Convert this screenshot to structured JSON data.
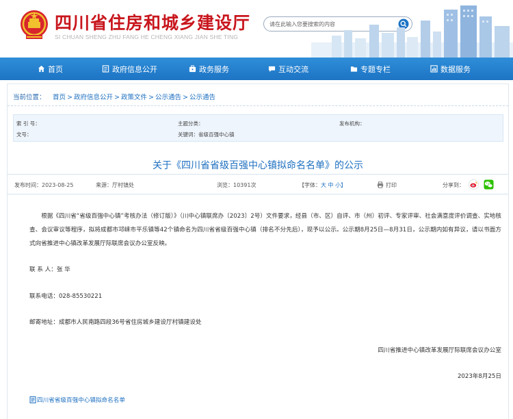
{
  "header": {
    "site_title": "四川省住房和城乡建设厅",
    "site_pinyin": "SI CHUAN SHENG ZHU FANG HE CHENG XIANG JIAN SHE TING",
    "search_placeholder": "请在此输入您要搜索的内容"
  },
  "nav": {
    "items": [
      {
        "label": "首页",
        "icon": "home-icon"
      },
      {
        "label": "政府信息公开",
        "icon": "document-icon"
      },
      {
        "label": "政务服务",
        "icon": "service-icon"
      },
      {
        "label": "互动交流",
        "icon": "chat-icon"
      },
      {
        "label": "专题专栏",
        "icon": "folder-icon"
      },
      {
        "label": "数据服务",
        "icon": "data-icon"
      }
    ]
  },
  "breadcrumb": {
    "label": "当前位置：",
    "items": [
      "首页",
      "政府信息公开",
      "政策文件",
      "公示通告",
      "公示通告"
    ],
    "separator": ">"
  },
  "meta": {
    "index_no": "索 引 号：",
    "doc_no": "文号：",
    "category": "主题分类：",
    "keywords": "关键词：省级百强中心镇",
    "issuer": "发布机构："
  },
  "article": {
    "title": "关于《四川省省级百强中心镇拟命名名单》的公示",
    "publish_date": "发布时间：2023-08-25",
    "source": "来源：厅村镇处",
    "views": "浏览：10391次",
    "font_label": "【字体：",
    "font_sizes": "大 中 小】",
    "print": "打印",
    "share_label": "分享到：",
    "body": "根据《四川省“省级百强中心镇”考核办法（修订版）》（川中心镇联席办〔2023〕2号）文件要求，经县（市、区）自评、市（州）初评、专家评审、社会满意度评价调查、实地核查、会议审议等程序，拟将成都市邛崃市平乐镇等42个镇命名为四川省省级百强中心镇（排名不分先后），现予以公示。公示期8月25日—8月31日，公示期内如有异议，请以书面方式向省推进中心镇改革发展厅际联席会议办公室反映。",
    "contact_person": "联 系 人：张 华",
    "contact_phone": "联系电话：028-85530221",
    "address": "邮寄地址：成都市人民南路四段36号省住房城乡建设厅村镇建设处",
    "signature": "四川省推进中心镇改革发展厅际联席会议办公室",
    "date": "2023年8月25日",
    "attachment": "四川省省级百强中心镇拟命名名单"
  },
  "colors": {
    "brand_red": "#c8161d",
    "nav_blue": "#1d74c4",
    "link_blue": "#1d6fc0"
  }
}
